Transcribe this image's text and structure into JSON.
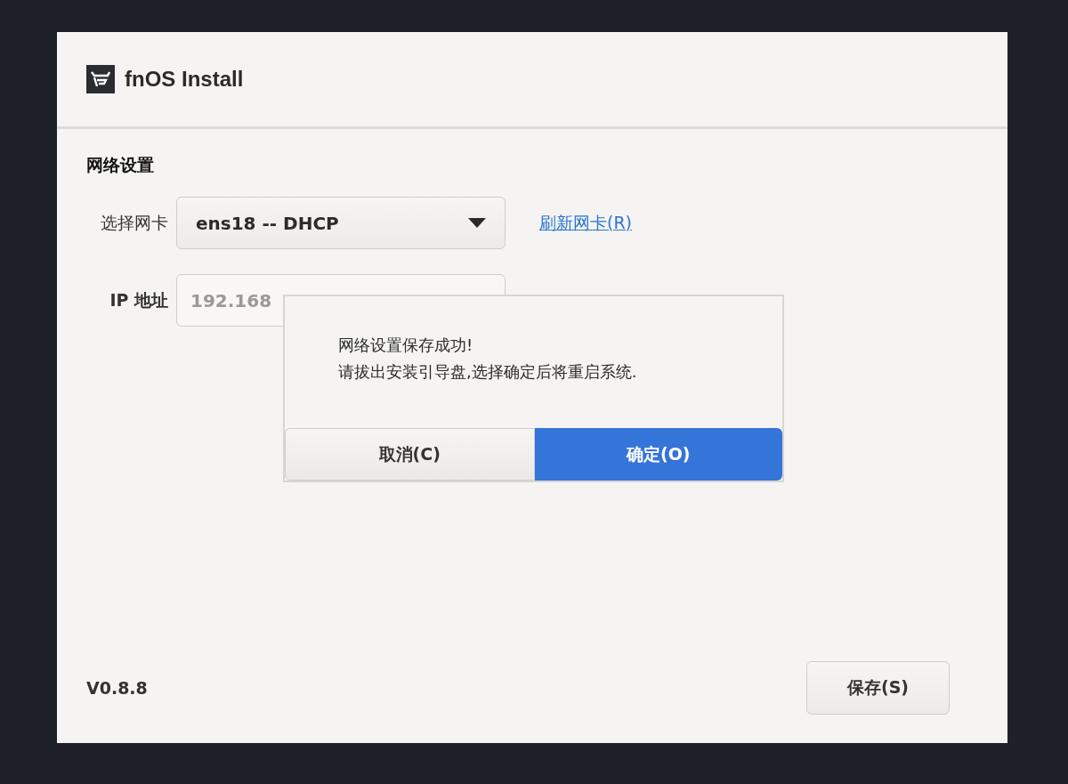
{
  "window": {
    "title": "fnOS Install"
  },
  "section": {
    "title": "网络设置"
  },
  "nic": {
    "label": "选择网卡",
    "value": "ens18 -- DHCP",
    "refresh_link": "刷新网卡(R)"
  },
  "ip": {
    "label": "IP 地址",
    "value": "192.168",
    "disabled": true
  },
  "dialog": {
    "lines": [
      "网络设置保存成功!",
      "请拔出安装引导盘,选择确定后将重启系统."
    ],
    "buttons": [
      {
        "label": "取消(C)",
        "kind": "secondary"
      },
      {
        "label": "确定(O)",
        "kind": "primary"
      }
    ]
  },
  "footer": {
    "version": "V0.8.8",
    "save_button": "保存(S)"
  }
}
